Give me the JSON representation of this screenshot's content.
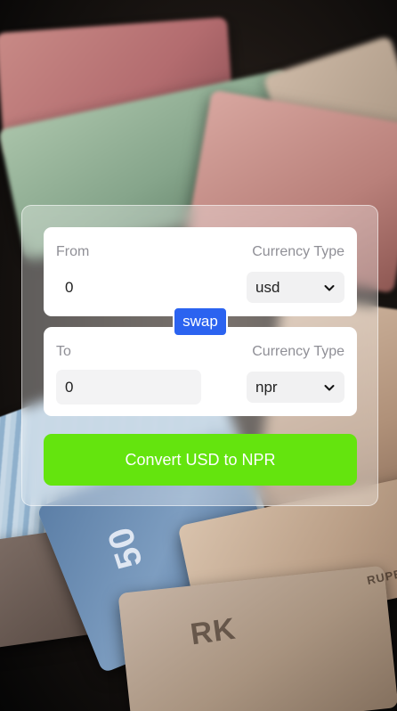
{
  "background": {
    "note_texts": [
      "50",
      "RUPE",
      "RK"
    ]
  },
  "converter": {
    "swap_label": "swap",
    "convert_label": "Convert USD to NPR",
    "from": {
      "label": "From",
      "currency_type_label": "Currency Type",
      "amount": "0",
      "currency": "usd"
    },
    "to": {
      "label": "To",
      "currency_type_label": "Currency Type",
      "amount": "0",
      "currency": "npr"
    }
  },
  "colors": {
    "swap_button": "#2b63f0",
    "convert_button": "#64e40e",
    "label_text": "#8f8f96"
  },
  "icons": {
    "select_indicator": "chevron-down-icon"
  }
}
